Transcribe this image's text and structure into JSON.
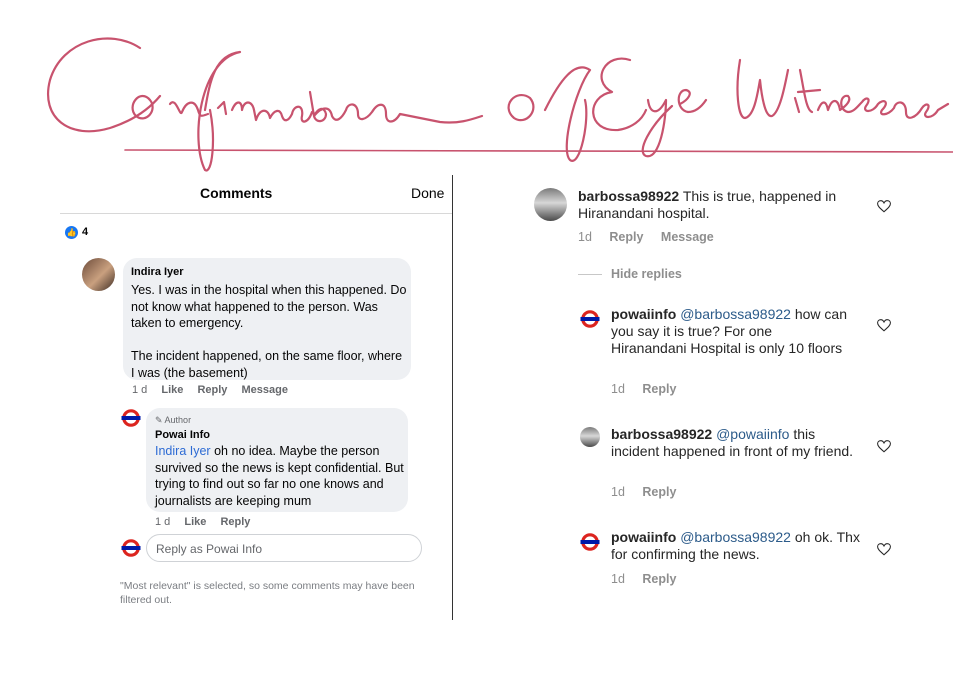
{
  "title": "Confirmation of Eye Witnesses",
  "facebook": {
    "header_title": "Comments",
    "done_label": "Done",
    "like_count": "4",
    "comment": {
      "author": "Indira Iyer",
      "text": "Yes. I was in the hospital when this happened. Do not know what happened to the person. Was taken to emergency.\n\nThe incident happened, on the same floor, where I was (the basement)",
      "time": "1 d",
      "actions": [
        "Like",
        "Reply",
        "Message"
      ]
    },
    "reply": {
      "tag": "Author",
      "author": "Powai Info",
      "mention": "Indira Iyer",
      "text": " oh no idea. Maybe the person survived so the news is kept confidential. But trying to find out so far no one knows and journalists are keeping mum",
      "time": "1 d",
      "actions": [
        "Like",
        "Reply"
      ]
    },
    "reply_placeholder": "Reply as Powai Info",
    "filter_note": "\"Most relevant\" is selected, so some comments may have been filtered out.",
    "logo_color": "#dc241f",
    "logo_bar_color": "#0019a8"
  },
  "instagram": {
    "hide_replies": "Hide replies",
    "comments": [
      {
        "user": "barbossa98922",
        "mention": "",
        "text": "This is true, happened in Hiranandani hospital.",
        "time": "1d",
        "actions": [
          "Reply",
          "Message"
        ]
      },
      {
        "user": "powaiinfo",
        "mention": "@barbossa98922",
        "text": "how can you say it is true? For one Hiranandani Hospital is only 10 floors",
        "time": "1d",
        "actions": [
          "Reply"
        ]
      },
      {
        "user": "barbossa98922",
        "mention": "@powaiinfo",
        "text": "this incident happened in front of my friend.",
        "time": "1d",
        "actions": [
          "Reply"
        ]
      },
      {
        "user": "powaiinfo",
        "mention": "@barbossa98922",
        "text": "oh ok. Thx for confirming the news.",
        "time": "1d",
        "actions": [
          "Reply"
        ]
      }
    ]
  },
  "colors": {
    "handwriting": "#c8536e"
  }
}
